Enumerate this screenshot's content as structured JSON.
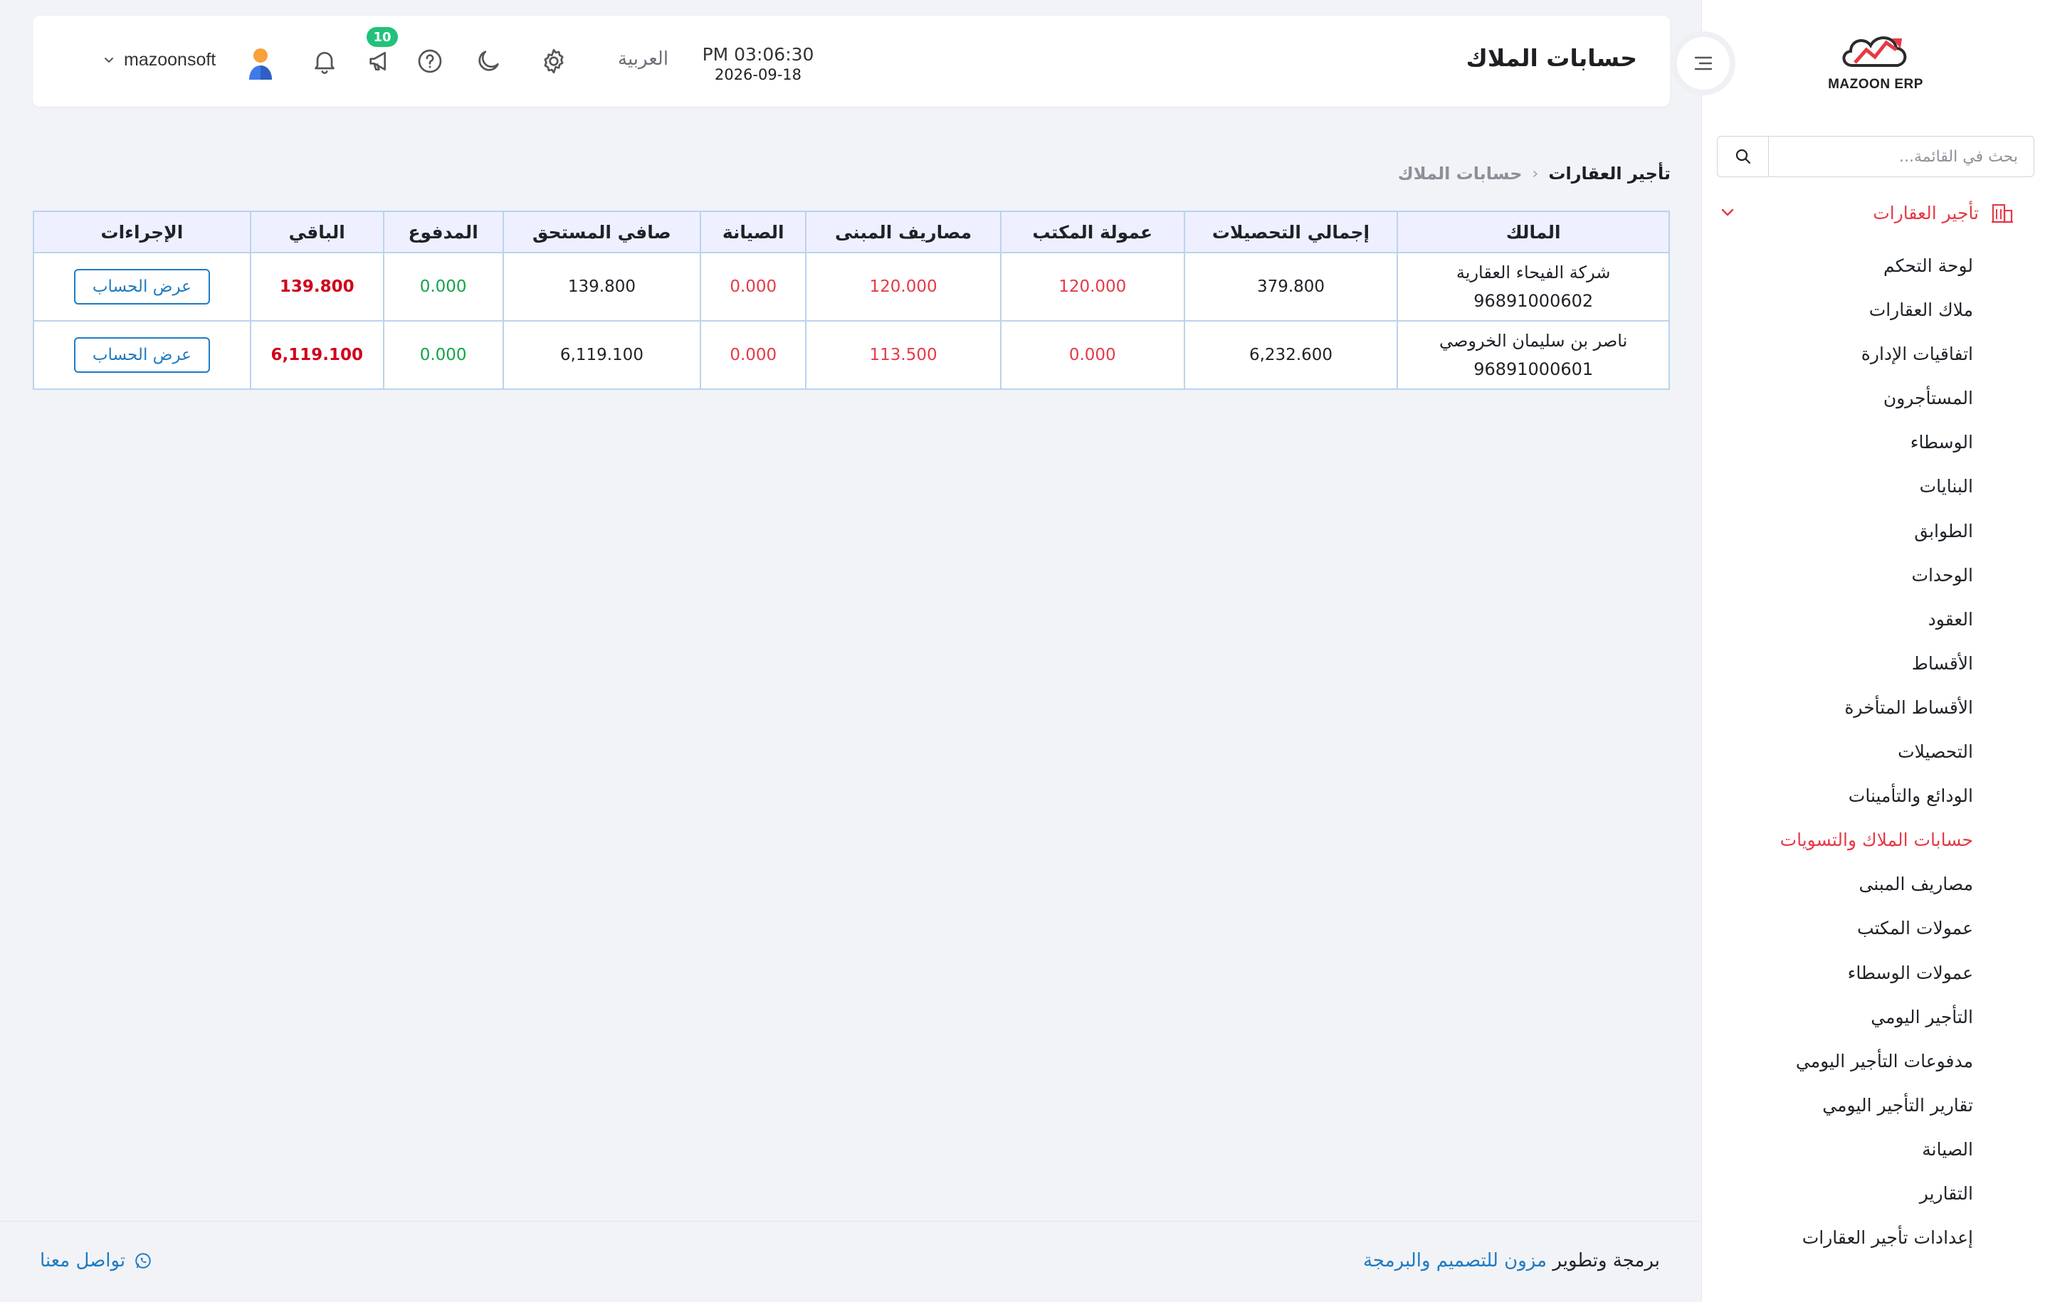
{
  "sidebar": {
    "logo_text": "MAZOON ERP",
    "search_placeholder": "بحث في القائمة...",
    "group_title": "تأجير العقارات",
    "items": [
      {
        "label": "لوحة التحكم"
      },
      {
        "label": "ملاك العقارات"
      },
      {
        "label": "اتفاقيات الإدارة"
      },
      {
        "label": "المستأجرون"
      },
      {
        "label": "الوسطاء"
      },
      {
        "label": "البنايات"
      },
      {
        "label": "الطوابق"
      },
      {
        "label": "الوحدات"
      },
      {
        "label": "العقود"
      },
      {
        "label": "الأقساط"
      },
      {
        "label": "الأقساط المتأخرة"
      },
      {
        "label": "التحصيلات"
      },
      {
        "label": "الودائع والتأمينات"
      },
      {
        "label": "حسابات الملاك والتسويات",
        "active": true
      },
      {
        "label": "مصاريف المبنى"
      },
      {
        "label": "عمولات المكتب"
      },
      {
        "label": "عمولات الوسطاء"
      },
      {
        "label": "التأجير اليومي"
      },
      {
        "label": "مدفوعات التأجير اليومي"
      },
      {
        "label": "تقارير التأجير اليومي"
      },
      {
        "label": "الصيانة"
      },
      {
        "label": "التقارير"
      },
      {
        "label": "إعدادات تأجير العقارات"
      }
    ]
  },
  "header": {
    "title": "حسابات الملاك",
    "time": "PM 03:06:30",
    "date": "2026-09-18",
    "language": "العربية",
    "notifications_count": "10",
    "username": "mazoonsoft"
  },
  "breadcrumb": {
    "root": "تأجير العقارات",
    "current": "حسابات الملاك"
  },
  "table": {
    "columns": [
      "المالك",
      "إجمالي التحصيلات",
      "عمولة المكتب",
      "مصاريف المبنى",
      "الصيانة",
      "صافي المستحق",
      "المدفوع",
      "الباقي",
      "الإجراءات"
    ],
    "rows": [
      {
        "owner_name": "شركة الفيحاء العقارية",
        "owner_phone": "96891000602",
        "total_collections": "379.800",
        "office_commission": "120.000",
        "building_expenses": "120.000",
        "maintenance": "0.000",
        "net_due": "139.800",
        "paid": "0.000",
        "remaining": "139.800",
        "action": "عرض الحساب"
      },
      {
        "owner_name": "ناصر بن سليمان الخروصي",
        "owner_phone": "96891000601",
        "total_collections": "6,232.600",
        "office_commission": "0.000",
        "building_expenses": "113.500",
        "maintenance": "0.000",
        "net_due": "6,119.100",
        "paid": "0.000",
        "remaining": "6,119.100",
        "action": "عرض الحساب"
      }
    ]
  },
  "footer": {
    "credit_prefix": "برمجة وتطوير",
    "credit_link": "مزون للتصميم والبرمجة",
    "contact": "تواصل معنا"
  },
  "colors": {
    "accent_red": "#e63946",
    "link_blue": "#1f7bc1",
    "positive_green": "#15a34a",
    "badge_green": "#21c27a"
  }
}
